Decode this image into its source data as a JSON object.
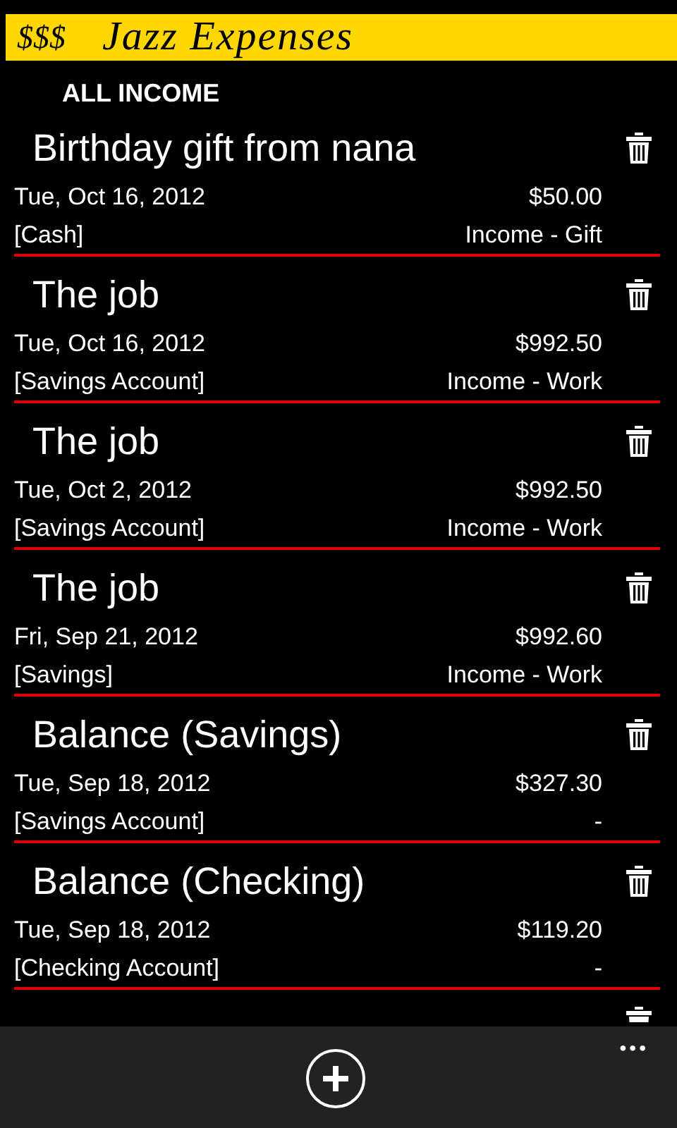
{
  "header": {
    "symbol": "$$$",
    "title": "Jazz Expenses"
  },
  "page_title": "ALL INCOME",
  "entries": [
    {
      "title": "Birthday gift from nana",
      "date": "Tue, Oct 16, 2012",
      "amount": "$50.00",
      "account": "[Cash]",
      "category": "Income - Gift"
    },
    {
      "title": "The job",
      "date": "Tue, Oct 16, 2012",
      "amount": "$992.50",
      "account": "[Savings Account]",
      "category": "Income - Work"
    },
    {
      "title": "The job",
      "date": "Tue, Oct 2, 2012",
      "amount": "$992.50",
      "account": "[Savings Account]",
      "category": "Income - Work"
    },
    {
      "title": "The job",
      "date": "Fri, Sep 21, 2012",
      "amount": "$992.60",
      "account": "[Savings]",
      "category": "Income - Work"
    },
    {
      "title": "Balance (Savings)",
      "date": "Tue, Sep 18, 2012",
      "amount": "$327.30",
      "account": "[Savings Account]",
      "category": "-"
    },
    {
      "title": "Balance (Checking)",
      "date": "Tue, Sep 18, 2012",
      "amount": "$119.20",
      "account": "[Checking Account]",
      "category": "-"
    },
    {
      "kind": "partial"
    }
  ],
  "app_bar": {
    "more": "•••"
  }
}
